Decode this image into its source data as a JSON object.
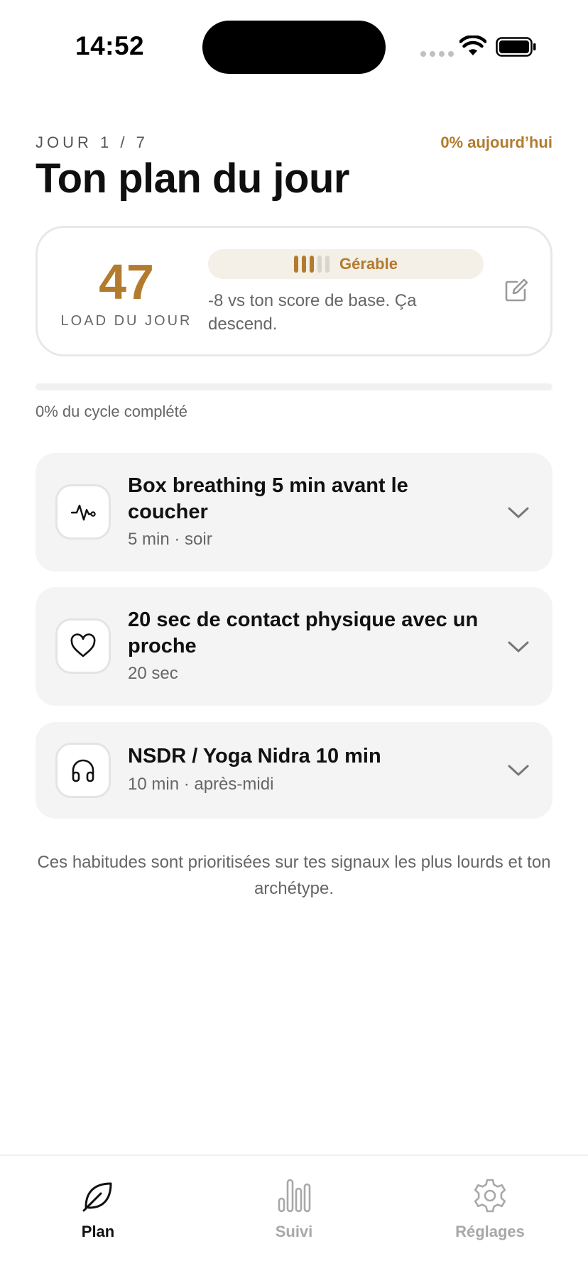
{
  "status_bar": {
    "time": "14:52"
  },
  "header": {
    "day_label": "JOUR 1 / 7",
    "today_progress": "0% aujourd’hui",
    "title": "Ton plan du jour"
  },
  "load_card": {
    "value": "47",
    "label": "LOAD DU JOUR",
    "status": "Gérable",
    "level_filled": 3,
    "level_total": 5,
    "description": "-8 vs ton score de base. Ça descend."
  },
  "cycle": {
    "progress_percent": 0,
    "label": "0% du cycle complété"
  },
  "habits": [
    {
      "title": "Box breathing 5 min avant le coucher",
      "meta": "5 min · soir",
      "icon": "pulse-icon"
    },
    {
      "title": "20 sec de contact physique avec un proche",
      "meta": "20 sec",
      "icon": "heart-icon"
    },
    {
      "title": "NSDR / Yoga Nidra 10 min",
      "meta": "10 min · après-midi",
      "icon": "headphones-icon"
    }
  ],
  "footnote": "Ces habitudes sont prioritisées sur tes signaux les plus lourds et ton archétype.",
  "tabs": [
    {
      "label": "Plan",
      "icon": "leaf-icon",
      "active": true
    },
    {
      "label": "Suivi",
      "icon": "bar-chart-icon",
      "active": false
    },
    {
      "label": "Réglages",
      "icon": "gear-icon",
      "active": false
    }
  ],
  "colors": {
    "accent": "#b27b2e",
    "pill_bg": "#f4efe7",
    "card_bg": "#f4f4f4",
    "muted_text": "#666666",
    "inactive_tab": "#a8a8a8"
  }
}
